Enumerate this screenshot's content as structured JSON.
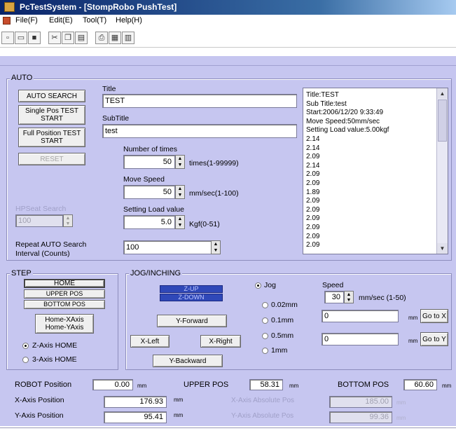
{
  "window": {
    "title": "PcTestSystem - [StompRobo PushTest]"
  },
  "menu": [
    {
      "label": "File(F)"
    },
    {
      "label": "Edit(E)"
    },
    {
      "label": "Tool(T)"
    },
    {
      "label": "Help(H)"
    }
  ],
  "toolbar": {
    "buttons": [
      "new-file",
      "open-folder",
      "save",
      "cut",
      "copy",
      "paste",
      "print",
      "view",
      "help"
    ]
  },
  "auto": {
    "group_label": "AUTO",
    "buttons": {
      "auto_search": "AUTO SEARCH",
      "single_pos": "Single Pos TEST START",
      "full_position": "Full Position TEST START",
      "reset": "RESET"
    },
    "title_label": "Title",
    "title_value": "TEST",
    "subtitle_label": "SubTitle",
    "subtitle_value": "test",
    "number_of_times": {
      "label": "Number of times",
      "value": "50",
      "unit": "times(1-99999)"
    },
    "move_speed": {
      "label": "Move Speed",
      "value": "50",
      "unit": "mm/sec(1-100)"
    },
    "setting_load": {
      "label": "Setting Load value",
      "value": "5.0",
      "unit": "Kgf(0-51)"
    },
    "left_disabled_label": "HPSeat Search",
    "left_disabled_value": "100",
    "repeat_label_1": "Repeat AUTO Search",
    "repeat_label_2": "Interval (Counts)",
    "repeat_value": "100",
    "log_lines": [
      "Title:TEST",
      "Sub Title:test",
      "Start:2006/12/20 9:33:49",
      "Move Speed:50mm/sec",
      "Setting Load value:5.00kgf",
      "2.14",
      "2.14",
      "2.09",
      "2.14",
      "2.09",
      "2.09",
      "1.89",
      "2.09",
      "2.09",
      "2.09",
      "2.09",
      "2.09",
      "2.09"
    ]
  },
  "step": {
    "group_label": "STEP",
    "buttons": {
      "home": "HOME",
      "upper_pos": "UPPER POS",
      "bottom_pos": "BOTTOM POS",
      "home_axes": "Home-XAxis Home-YAxis"
    },
    "radios": [
      {
        "label": "Z-Axis HOME",
        "checked": true
      },
      {
        "label": "3-Axis HOME",
        "checked": false
      }
    ]
  },
  "jog": {
    "group_label": "JOG/INCHING",
    "z_up": "Z-UP",
    "z_down": "Z-DOWN",
    "y_forward": "Y-Forward",
    "x_left": "X-Left",
    "x_right": "X-Right",
    "y_backward": "Y-Backward",
    "modes": [
      {
        "label": "Jog",
        "checked": true
      },
      {
        "label": "0.02mm",
        "checked": false
      },
      {
        "label": "0.1mm",
        "checked": false
      },
      {
        "label": "0.5mm",
        "checked": false
      },
      {
        "label": "1mm",
        "checked": false
      }
    ],
    "speed_label": "Speed",
    "speed_value": "30",
    "speed_unit": "mm/sec (1-50)",
    "goto_x_value": "0",
    "goto_y_value": "0",
    "mm_unit": "mm",
    "goto_x": "Go to X",
    "goto_y": "Go to Y"
  },
  "positions": {
    "robot_label": "ROBOT Position",
    "robot_value": "0.00",
    "robot_unit": "mm",
    "upper_label": "UPPER POS",
    "upper_value": "58.31",
    "upper_unit": "mm",
    "bottom_label": "BOTTOM POS",
    "bottom_value": "60.60",
    "bottom_unit": "mm",
    "x_label": "X-Axis Position",
    "x_value": "176.93",
    "x_unit": "mm",
    "y_label": "Y-Axis Position",
    "y_value": "95.41",
    "y_unit": "mm",
    "x_abs_label": "X-Axis Absolute Pos",
    "x_abs_value": "185.00",
    "x_abs_unit": "mm",
    "y_abs_label": "Y-Axis Absolute Pos",
    "y_abs_value": "99.36",
    "y_abs_unit": "mm"
  }
}
